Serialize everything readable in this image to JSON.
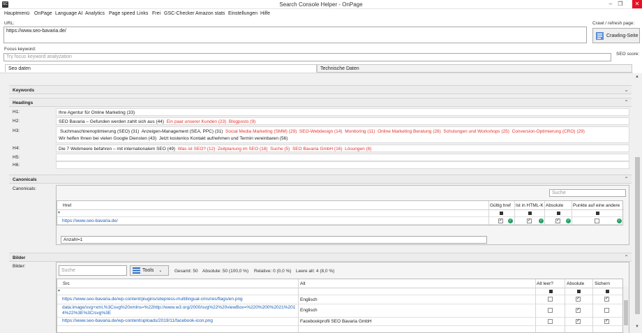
{
  "window": {
    "title": "Search Console Helper - OnPage"
  },
  "menu": [
    "Hauptmenü",
    "OnPage",
    "Language AI",
    "Analytics",
    "Page speed",
    "Links",
    "Frei",
    "GSC-Checker",
    "Amazon stats",
    "Einstellungen",
    "Hilfe"
  ],
  "url": {
    "label": "URL:",
    "value": "https://www.seo-bavaria.de/"
  },
  "crawl": {
    "label": "Crawl / refresh page:",
    "button": "Crawling-Seite"
  },
  "focus": {
    "label": "Focus keyword:",
    "placeholder": "Try focus keyword analyzation",
    "seo_score_label": "SEO score:"
  },
  "tabs": [
    "Seo daten",
    "Technische Daten"
  ],
  "sections": {
    "keywords": "Keywords",
    "headings": "Headings",
    "canonicals": "Canonicals",
    "bilder": "Bilder"
  },
  "headings": {
    "h1": {
      "label": "H1:",
      "items": [
        {
          "text": "Ihre Agentur für Online Marketing (33)",
          "color": "black"
        }
      ]
    },
    "h2": {
      "label": "H2:",
      "items": [
        {
          "text": "SEO Bavaria – Gefunden werden zahlt sich aus (44)",
          "color": "black"
        },
        {
          "text": "Ein paar unserer Kunden (23)",
          "color": "red"
        },
        {
          "text": "Blogposts (9)",
          "color": "red"
        }
      ]
    },
    "h3": {
      "label": "H3:",
      "line1": [
        {
          "text": "Suchmaschinenoptimierung (SEO) (31)",
          "color": "black"
        },
        {
          "text": "Anzeigen-Management (SEA, PPC) (31)",
          "color": "black"
        },
        {
          "text": "Social Media Marketing (SMM) (29)",
          "color": "red"
        },
        {
          "text": "SEO-Webdesign (14)",
          "color": "red"
        },
        {
          "text": "Monitoring (11)",
          "color": "red"
        },
        {
          "text": "Online Marketing Beratung (26)",
          "color": "red"
        },
        {
          "text": "Schulungen und Workshops (25)",
          "color": "red"
        },
        {
          "text": "Conversion-Optimierung (CRO) (29)",
          "color": "red"
        }
      ],
      "line2": [
        {
          "text": "Wir helfen Ihnen bei vielen Google Diensten (43)",
          "color": "black"
        },
        {
          "text": "Jetzt kostenlos Kontakt aufnehmen und Termin vereinbaren (56)",
          "color": "black"
        }
      ]
    },
    "h4": {
      "label": "H4:",
      "items": [
        {
          "text": "Die 7 Webmeere befahren – mit internationalem SEO (49)",
          "color": "black"
        },
        {
          "text": "Was ist SEO? (12)",
          "color": "red"
        },
        {
          "text": "Zeitplanung im SEO (18)",
          "color": "red"
        },
        {
          "text": "Suche (5)",
          "color": "red"
        },
        {
          "text": "SEO Bavaria GmbH (16)",
          "color": "red"
        },
        {
          "text": "Lösungen (8)",
          "color": "red"
        }
      ]
    },
    "h5": {
      "label": "H5:"
    },
    "h6": {
      "label": "H6:"
    }
  },
  "canonicals": {
    "label": "Canonicals:",
    "search_placeholder": "Suche",
    "columns": [
      "Href",
      "Gültig href",
      "Ist in HTML-Kopf",
      "Absolute",
      "Punkte auf eine andere"
    ],
    "rows": [
      {
        "href": "https://www.seo-bavaria.de/"
      }
    ],
    "count_text": "Anzahl=1"
  },
  "bilder": {
    "label": "Bilder:",
    "search_placeholder": "Suche",
    "tools_label": "Tools",
    "stats": [
      "Gesamt: 50",
      "Absolute: 50 (100,0 %)",
      "Relative: 0 (0,0 %)",
      "Leere alt: 4 (8,0 %)"
    ],
    "columns": [
      "Src",
      "Alt",
      "Alt leer?",
      "Absolute",
      "Sichern"
    ],
    "rows": [
      {
        "src": "https://www.seo-bavaria.de/wp-content/plugins/sitepress-multilingual-cms/res/flags/en.png",
        "alt": "Englisch",
        "alt_empty": false,
        "absolute": true,
        "secure": true
      },
      {
        "src": "data:image/svg+xml,%3Csvg%20xmlns=%22http://www.w3.org/2000/svg%22%20viewBox=%220%200%2021%2014%22%3E%3C/svg%3E",
        "alt": "Englisch",
        "alt_empty": false,
        "absolute": true,
        "secure": false
      },
      {
        "src": "https://www.seo-bavaria.de/wp-content/uploads/2019/11/facebook-icon.png",
        "alt": "Facebookprofil SEO Bavaria GmbH",
        "alt_empty": false,
        "absolute": true,
        "secure": true
      }
    ]
  },
  "colors": {
    "accent_red": "#e3342f",
    "link_blue": "#1a5fb4",
    "ok_green": "#21a366",
    "close_red": "#e81123"
  }
}
